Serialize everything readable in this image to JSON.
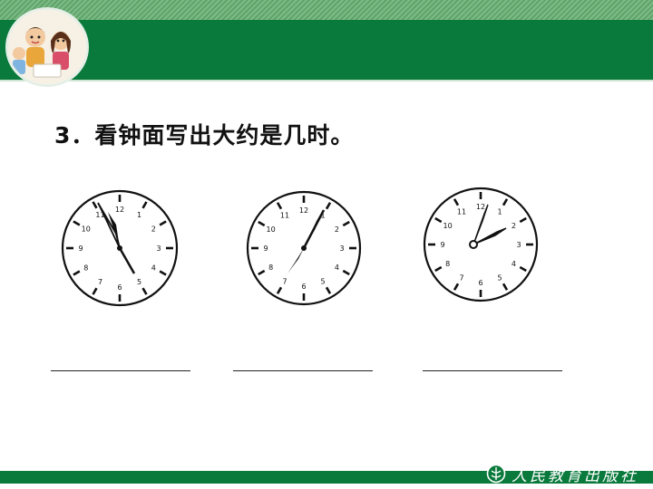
{
  "question": {
    "text": "3．看钟面写出大约是几时。"
  },
  "publisher": {
    "name": "人民教育出版社",
    "logo_icon": "pep-logo-icon"
  },
  "clocks": [
    {
      "name": "clock-1",
      "icon": "clock-icon",
      "numbers": [
        "12",
        "1",
        "2",
        "3",
        "4",
        "5",
        "6",
        "7",
        "8",
        "9",
        "10",
        "11"
      ]
    },
    {
      "name": "clock-2",
      "icon": "clock-icon",
      "numbers": [
        "12",
        "1",
        "2",
        "3",
        "4",
        "5",
        "6",
        "7",
        "8",
        "9",
        "10",
        "11"
      ]
    },
    {
      "name": "clock-3",
      "icon": "clock-icon",
      "numbers": [
        "12",
        "1",
        "2",
        "3",
        "4",
        "5",
        "6",
        "7",
        "8",
        "9",
        "10",
        "11"
      ]
    }
  ],
  "colors": {
    "header": "#0a7a3c",
    "stripe": "#7dbb86",
    "text": "#111111"
  }
}
